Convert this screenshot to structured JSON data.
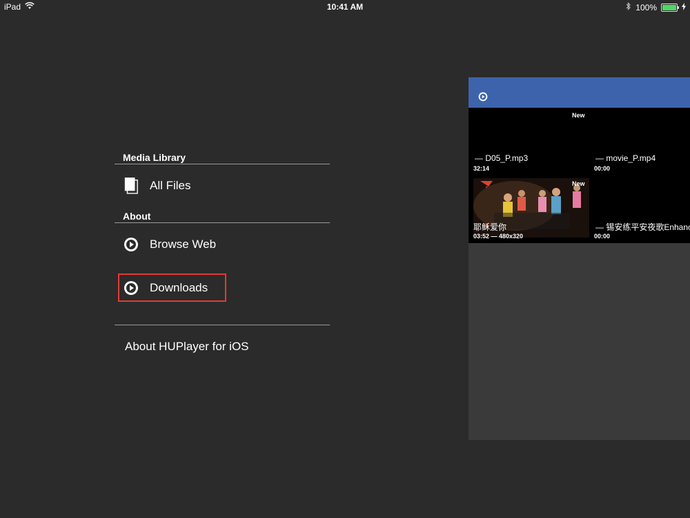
{
  "status_bar": {
    "device": "iPad",
    "time": "10:41 AM",
    "battery": "100%"
  },
  "menu": {
    "media_library_header": "Media Library",
    "all_files_label": "All Files",
    "about_header": "About",
    "browse_web_label": "Browse Web",
    "downloads_label": "Downloads",
    "about_app_label": "About HUPlayer for iOS"
  },
  "preview_panel": {
    "top_badge": "New",
    "items": [
      {
        "title": "— D05_P.mp3",
        "duration": "32:14"
      },
      {
        "title": "— movie_P.mp4",
        "duration": "00:00"
      },
      {
        "title": "耶稣爱你",
        "duration": "03:52 — 480x320",
        "badge": "New"
      },
      {
        "title": "— 锡安练平安夜歌Enhance",
        "duration": "00:00"
      }
    ]
  }
}
